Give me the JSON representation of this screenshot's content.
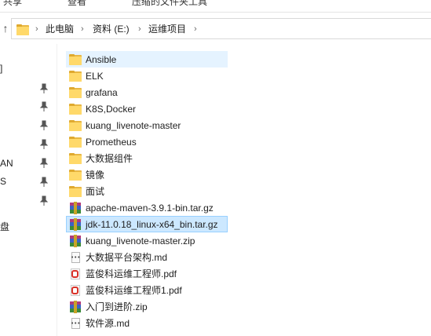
{
  "ribbon": {
    "tabs": [
      "共享",
      "查看",
      "压缩的文件夹工具"
    ]
  },
  "address_bar": {
    "crumbs": [
      "此电脑",
      "资料 (E:)",
      "运维项目"
    ],
    "separator": ">"
  },
  "nav_pane": {
    "fragments": [
      "]",
      "AN",
      "S",
      "盘"
    ]
  },
  "files": [
    {
      "name": "Ansible",
      "type": "folder",
      "state": "hover"
    },
    {
      "name": "ELK",
      "type": "folder"
    },
    {
      "name": "grafana",
      "type": "folder"
    },
    {
      "name": "K8S,Docker",
      "type": "folder"
    },
    {
      "name": "kuang_livenote-master",
      "type": "folder"
    },
    {
      "name": "Prometheus",
      "type": "folder"
    },
    {
      "name": "大数据组件",
      "type": "folder"
    },
    {
      "name": "镜像",
      "type": "folder"
    },
    {
      "name": "面试",
      "type": "folder"
    },
    {
      "name": "apache-maven-3.9.1-bin.tar.gz",
      "type": "archive"
    },
    {
      "name": "jdk-11.0.18_linux-x64_bin.tar.gz",
      "type": "archive",
      "state": "selected"
    },
    {
      "name": "kuang_livenote-master.zip",
      "type": "archive"
    },
    {
      "name": "大数据平台架构.md",
      "type": "md"
    },
    {
      "name": "蓝俊科运维工程师.pdf",
      "type": "pdf"
    },
    {
      "name": "蓝俊科运维工程师1.pdf",
      "type": "pdf"
    },
    {
      "name": "入门到进阶.zip",
      "type": "archive"
    },
    {
      "name": "软件源.md",
      "type": "md"
    }
  ],
  "colors": {
    "selection_bg": "#cce8ff",
    "hover_bg": "#e5f3ff",
    "folder": "#ffd96a"
  }
}
